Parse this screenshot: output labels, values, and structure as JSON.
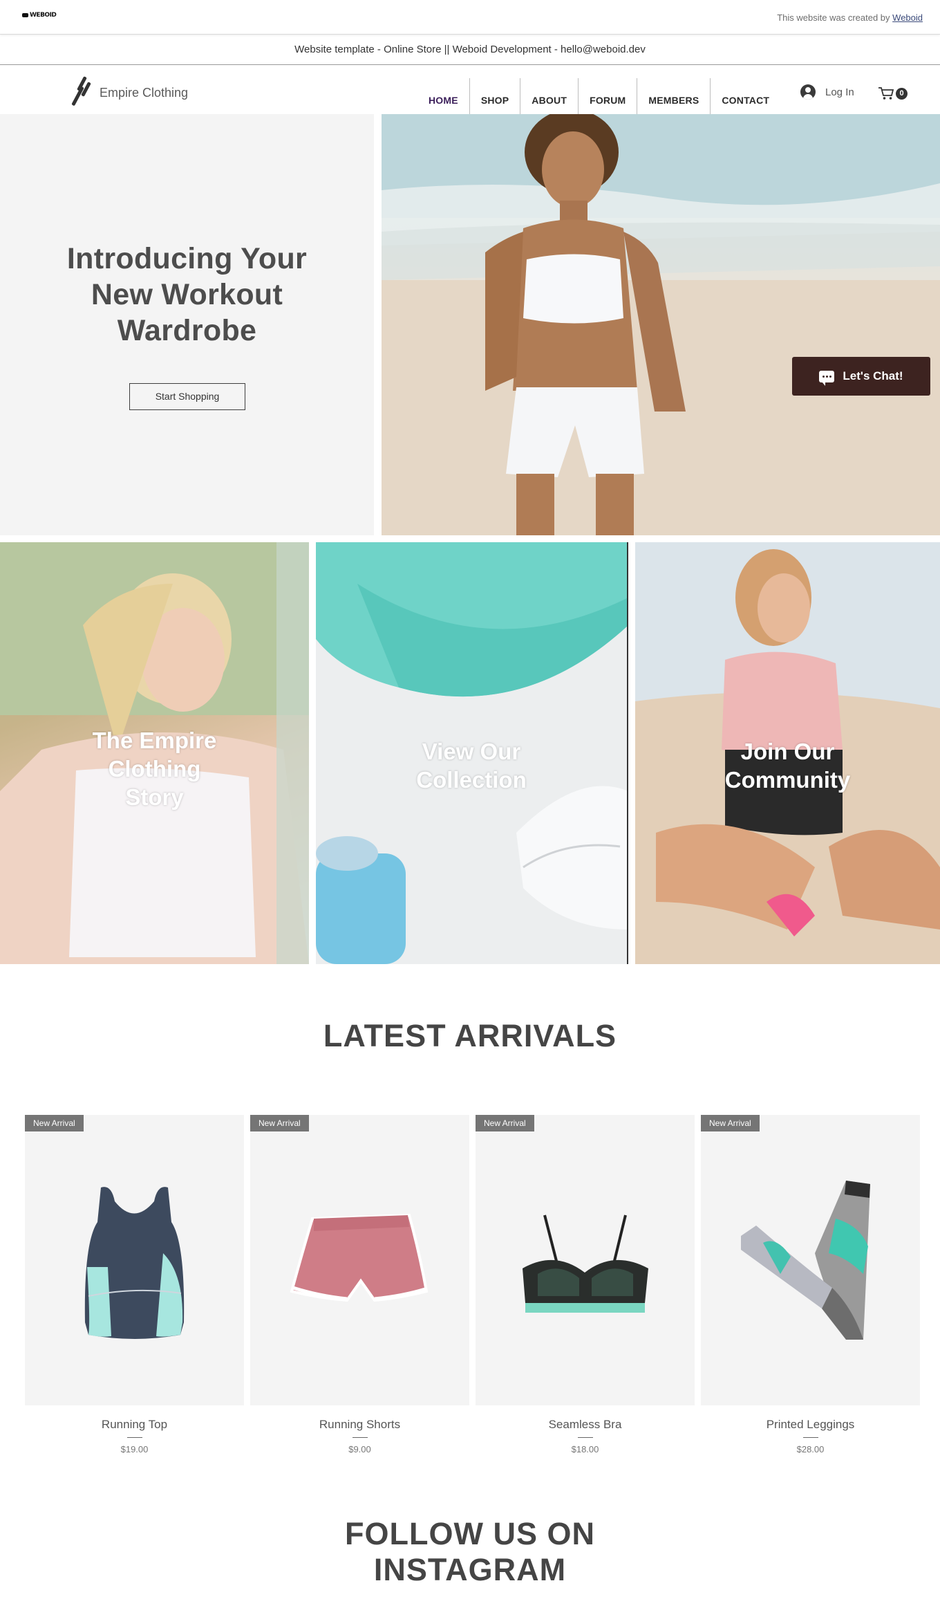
{
  "creator_bar": {
    "logo_text": "WEBOID",
    "text": "This website was created by",
    "link": "Weboid"
  },
  "template_bar": {
    "text": "Website template - Online Store || Weboid Development - hello@weboid.dev"
  },
  "header": {
    "brand": "Empire Clothing",
    "nav": [
      "HOME",
      "SHOP",
      "ABOUT",
      "FORUM",
      "MEMBERS",
      "CONTACT"
    ],
    "login": "Log In",
    "cart_count": "0"
  },
  "hero": {
    "title_lines": [
      "Introducing Your",
      "New Workout",
      "Wardrobe"
    ],
    "button": "Start Shopping"
  },
  "chat": {
    "label": "Let's Chat!"
  },
  "tiles": [
    {
      "lines": [
        "The Empire",
        "Clothing",
        "Story"
      ]
    },
    {
      "lines": [
        "View Our",
        "Collection"
      ]
    },
    {
      "lines": [
        "Join Our",
        "Community"
      ]
    }
  ],
  "latest": {
    "title": "LATEST ARRIVALS",
    "products": [
      {
        "badge": "New Arrival",
        "name": "Running Top",
        "price": "$19.00"
      },
      {
        "badge": "New Arrival",
        "name": "Running Shorts",
        "price": "$9.00"
      },
      {
        "badge": "New Arrival",
        "name": "Seamless Bra",
        "price": "$18.00"
      },
      {
        "badge": "New Arrival",
        "name": "Printed Leggings",
        "price": "$28.00"
      }
    ]
  },
  "instagram": {
    "title_lines": [
      "FOLLOW US ON",
      "INSTAGRAM"
    ]
  }
}
